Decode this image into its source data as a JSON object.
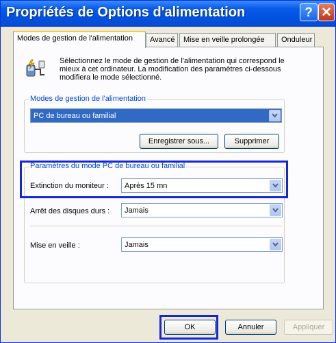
{
  "window": {
    "title": "Propriétés de Options d'alimentation"
  },
  "title_buttons": {
    "help": "?",
    "close": "✕"
  },
  "tabs": [
    {
      "label": "Modes de gestion de l'alimentation",
      "active": true
    },
    {
      "label": "Avancé",
      "active": false
    },
    {
      "label": "Mise en veille prolongée",
      "active": false
    },
    {
      "label": "Onduleur",
      "active": false
    }
  ],
  "intro": {
    "icon": "power-options-icon",
    "text": "Sélectionnez le mode de gestion de l'alimentation qui correspond le mieux à cet ordinateur. La modification des paramètres ci-dessous modifiera le mode sélectionné."
  },
  "schemes": {
    "group_label": "Modes de gestion de l'alimentation",
    "selected": "PC de bureau ou familial",
    "save_as": "Enregistrer sous...",
    "delete": "Supprimer"
  },
  "settings": {
    "group_label": "Paramètres du mode PC de bureau ou familial",
    "monitor_off": {
      "label": "Extinction du moniteur :",
      "value": "Après 15 mn"
    },
    "hard_disks_off": {
      "label": "Arrêt des disques durs :",
      "value": "Jamais"
    },
    "standby": {
      "label": "Mise en veille :",
      "value": "Jamais"
    }
  },
  "footer": {
    "ok": "OK",
    "cancel": "Annuler",
    "apply": "Appliquer"
  },
  "colors": {
    "titlebar": "#0054e3",
    "highlight": "#1426d8",
    "group_label": "#0046d5",
    "selection": "#316ac5"
  }
}
